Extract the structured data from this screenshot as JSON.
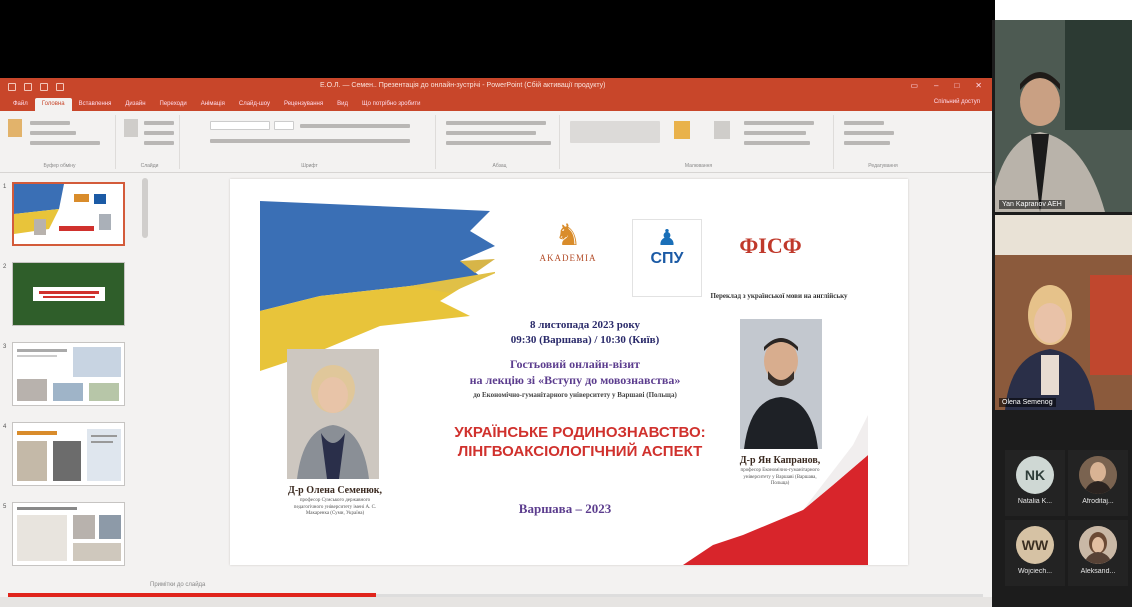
{
  "ppt": {
    "title": "Е.О.Л. — Семен.. Презентація до онлайн-зустрічі - PowerPoint (Сбій активації продукту)",
    "tabs": [
      "Файл",
      "Головна",
      "Вставлення",
      "Дизайн",
      "Переходи",
      "Анімація",
      "Слайд-шоу",
      "Рецензування",
      "Вид",
      "Що потрібно зробити"
    ],
    "share": "Спільний доступ",
    "groups": [
      "Буфер обміну",
      "Слайди",
      "Шрифт",
      "Абзац",
      "Малювання",
      "Редагування"
    ],
    "notes_placeholder": "Примітки до слайда",
    "progress_percent": 37.7
  },
  "slide": {
    "logo_academia": "AKADEMIA",
    "logo_spu": "СПУ",
    "logo_fisf": "ФІСФ",
    "translation": "Переклад з української мови на англійську",
    "date_line": "8 листопада 2023 року",
    "time_line": "09:30 (Варшава) / 10:30 (Київ)",
    "guest_line1": "Гостьовий онлайн-візит",
    "guest_line2": "на лекцію зі «Вступу до мовознавства»",
    "guest_line3": "до Економічно-гуманітарного університету у Варшаві (Польща)",
    "topic_line1": "УКРАЇНСЬКЕ РОДИНОЗНАВСТВО:",
    "topic_line2": "ЛІНГВОАКСІОЛОГІЧНИЙ АСПЕКТ",
    "city_year": "Варшава – 2023",
    "left_name": "Д-р Олена Семенюк,",
    "left_desc": "професор Сумського державного педагогічного університету імені А. С. Макаренка (Суми, Україна)",
    "right_name": "Д-р Ян Капранов,",
    "right_desc": "професор Економічно-гуманітарного університету у Варшаві (Варшава, Польща)"
  },
  "participants": {
    "video1_name": "Yan Kapranov AEH",
    "video2_name": "Olena Semenog",
    "p1_initials": "NK",
    "p1_name": "Natalia K...",
    "p2_name": "Afroditaj...",
    "p3_initials": "WW",
    "p3_name": "Wojciech...",
    "p4_name": "Aleksand..."
  }
}
